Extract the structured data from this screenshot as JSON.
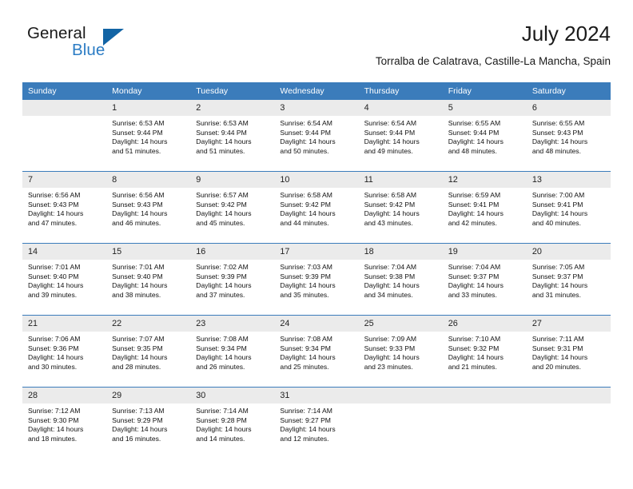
{
  "brand": {
    "word1": "General",
    "word2": "Blue",
    "triangle_color": "#1264a5",
    "blue_color": "#2b7cc4"
  },
  "header": {
    "title": "July 2024",
    "subtitle": "Torralba de Calatrava, Castille-La Mancha, Spain"
  },
  "theme": {
    "header_bg": "#3b7cbb",
    "daynum_bg": "#ebebeb",
    "text": "#111111"
  },
  "weekday_headers": [
    "Sunday",
    "Monday",
    "Tuesday",
    "Wednesday",
    "Thursday",
    "Friday",
    "Saturday"
  ],
  "weeks": [
    [
      {
        "day": "",
        "sunrise": "",
        "sunset": "",
        "daylight1": "",
        "daylight2": "",
        "blank": true
      },
      {
        "day": "1",
        "sunrise": "Sunrise: 6:53 AM",
        "sunset": "Sunset: 9:44 PM",
        "daylight1": "Daylight: 14 hours",
        "daylight2": "and 51 minutes."
      },
      {
        "day": "2",
        "sunrise": "Sunrise: 6:53 AM",
        "sunset": "Sunset: 9:44 PM",
        "daylight1": "Daylight: 14 hours",
        "daylight2": "and 51 minutes."
      },
      {
        "day": "3",
        "sunrise": "Sunrise: 6:54 AM",
        "sunset": "Sunset: 9:44 PM",
        "daylight1": "Daylight: 14 hours",
        "daylight2": "and 50 minutes."
      },
      {
        "day": "4",
        "sunrise": "Sunrise: 6:54 AM",
        "sunset": "Sunset: 9:44 PM",
        "daylight1": "Daylight: 14 hours",
        "daylight2": "and 49 minutes."
      },
      {
        "day": "5",
        "sunrise": "Sunrise: 6:55 AM",
        "sunset": "Sunset: 9:44 PM",
        "daylight1": "Daylight: 14 hours",
        "daylight2": "and 48 minutes."
      },
      {
        "day": "6",
        "sunrise": "Sunrise: 6:55 AM",
        "sunset": "Sunset: 9:43 PM",
        "daylight1": "Daylight: 14 hours",
        "daylight2": "and 48 minutes."
      }
    ],
    [
      {
        "day": "7",
        "sunrise": "Sunrise: 6:56 AM",
        "sunset": "Sunset: 9:43 PM",
        "daylight1": "Daylight: 14 hours",
        "daylight2": "and 47 minutes."
      },
      {
        "day": "8",
        "sunrise": "Sunrise: 6:56 AM",
        "sunset": "Sunset: 9:43 PM",
        "daylight1": "Daylight: 14 hours",
        "daylight2": "and 46 minutes."
      },
      {
        "day": "9",
        "sunrise": "Sunrise: 6:57 AM",
        "sunset": "Sunset: 9:42 PM",
        "daylight1": "Daylight: 14 hours",
        "daylight2": "and 45 minutes."
      },
      {
        "day": "10",
        "sunrise": "Sunrise: 6:58 AM",
        "sunset": "Sunset: 9:42 PM",
        "daylight1": "Daylight: 14 hours",
        "daylight2": "and 44 minutes."
      },
      {
        "day": "11",
        "sunrise": "Sunrise: 6:58 AM",
        "sunset": "Sunset: 9:42 PM",
        "daylight1": "Daylight: 14 hours",
        "daylight2": "and 43 minutes."
      },
      {
        "day": "12",
        "sunrise": "Sunrise: 6:59 AM",
        "sunset": "Sunset: 9:41 PM",
        "daylight1": "Daylight: 14 hours",
        "daylight2": "and 42 minutes."
      },
      {
        "day": "13",
        "sunrise": "Sunrise: 7:00 AM",
        "sunset": "Sunset: 9:41 PM",
        "daylight1": "Daylight: 14 hours",
        "daylight2": "and 40 minutes."
      }
    ],
    [
      {
        "day": "14",
        "sunrise": "Sunrise: 7:01 AM",
        "sunset": "Sunset: 9:40 PM",
        "daylight1": "Daylight: 14 hours",
        "daylight2": "and 39 minutes."
      },
      {
        "day": "15",
        "sunrise": "Sunrise: 7:01 AM",
        "sunset": "Sunset: 9:40 PM",
        "daylight1": "Daylight: 14 hours",
        "daylight2": "and 38 minutes."
      },
      {
        "day": "16",
        "sunrise": "Sunrise: 7:02 AM",
        "sunset": "Sunset: 9:39 PM",
        "daylight1": "Daylight: 14 hours",
        "daylight2": "and 37 minutes."
      },
      {
        "day": "17",
        "sunrise": "Sunrise: 7:03 AM",
        "sunset": "Sunset: 9:39 PM",
        "daylight1": "Daylight: 14 hours",
        "daylight2": "and 35 minutes."
      },
      {
        "day": "18",
        "sunrise": "Sunrise: 7:04 AM",
        "sunset": "Sunset: 9:38 PM",
        "daylight1": "Daylight: 14 hours",
        "daylight2": "and 34 minutes."
      },
      {
        "day": "19",
        "sunrise": "Sunrise: 7:04 AM",
        "sunset": "Sunset: 9:37 PM",
        "daylight1": "Daylight: 14 hours",
        "daylight2": "and 33 minutes."
      },
      {
        "day": "20",
        "sunrise": "Sunrise: 7:05 AM",
        "sunset": "Sunset: 9:37 PM",
        "daylight1": "Daylight: 14 hours",
        "daylight2": "and 31 minutes."
      }
    ],
    [
      {
        "day": "21",
        "sunrise": "Sunrise: 7:06 AM",
        "sunset": "Sunset: 9:36 PM",
        "daylight1": "Daylight: 14 hours",
        "daylight2": "and 30 minutes."
      },
      {
        "day": "22",
        "sunrise": "Sunrise: 7:07 AM",
        "sunset": "Sunset: 9:35 PM",
        "daylight1": "Daylight: 14 hours",
        "daylight2": "and 28 minutes."
      },
      {
        "day": "23",
        "sunrise": "Sunrise: 7:08 AM",
        "sunset": "Sunset: 9:34 PM",
        "daylight1": "Daylight: 14 hours",
        "daylight2": "and 26 minutes."
      },
      {
        "day": "24",
        "sunrise": "Sunrise: 7:08 AM",
        "sunset": "Sunset: 9:34 PM",
        "daylight1": "Daylight: 14 hours",
        "daylight2": "and 25 minutes."
      },
      {
        "day": "25",
        "sunrise": "Sunrise: 7:09 AM",
        "sunset": "Sunset: 9:33 PM",
        "daylight1": "Daylight: 14 hours",
        "daylight2": "and 23 minutes."
      },
      {
        "day": "26",
        "sunrise": "Sunrise: 7:10 AM",
        "sunset": "Sunset: 9:32 PM",
        "daylight1": "Daylight: 14 hours",
        "daylight2": "and 21 minutes."
      },
      {
        "day": "27",
        "sunrise": "Sunrise: 7:11 AM",
        "sunset": "Sunset: 9:31 PM",
        "daylight1": "Daylight: 14 hours",
        "daylight2": "and 20 minutes."
      }
    ],
    [
      {
        "day": "28",
        "sunrise": "Sunrise: 7:12 AM",
        "sunset": "Sunset: 9:30 PM",
        "daylight1": "Daylight: 14 hours",
        "daylight2": "and 18 minutes."
      },
      {
        "day": "29",
        "sunrise": "Sunrise: 7:13 AM",
        "sunset": "Sunset: 9:29 PM",
        "daylight1": "Daylight: 14 hours",
        "daylight2": "and 16 minutes."
      },
      {
        "day": "30",
        "sunrise": "Sunrise: 7:14 AM",
        "sunset": "Sunset: 9:28 PM",
        "daylight1": "Daylight: 14 hours",
        "daylight2": "and 14 minutes."
      },
      {
        "day": "31",
        "sunrise": "Sunrise: 7:14 AM",
        "sunset": "Sunset: 9:27 PM",
        "daylight1": "Daylight: 14 hours",
        "daylight2": "and 12 minutes."
      },
      {
        "day": "",
        "sunrise": "",
        "sunset": "",
        "daylight1": "",
        "daylight2": "",
        "blank": true
      },
      {
        "day": "",
        "sunrise": "",
        "sunset": "",
        "daylight1": "",
        "daylight2": "",
        "blank": true
      },
      {
        "day": "",
        "sunrise": "",
        "sunset": "",
        "daylight1": "",
        "daylight2": "",
        "blank": true
      }
    ]
  ]
}
